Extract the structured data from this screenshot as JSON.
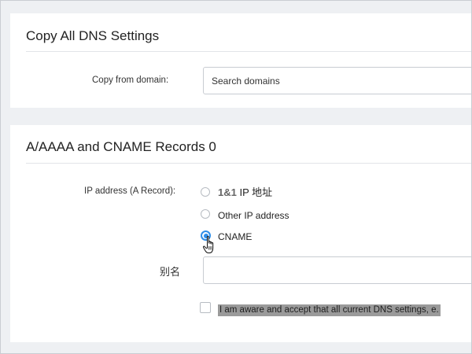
{
  "copy_section": {
    "title": "Copy All DNS Settings",
    "field_label": "Copy from domain:",
    "search_placeholder": "Search domains"
  },
  "records_section": {
    "title": "A/AAAA and CNAME Records 0",
    "ip_label": "IP address (A Record):",
    "options": [
      {
        "brand": "1&1",
        "label": " IP 地址",
        "selected": false
      },
      {
        "label": "Other IP address",
        "selected": false
      },
      {
        "label": "CNAME",
        "selected": true
      }
    ],
    "alias_label": "别名",
    "alias_value": "",
    "consent_text": "I am aware and accept that all current DNS settings, e.",
    "consent_checked": false
  },
  "colors": {
    "accent": "#2f8ee8",
    "page_background": "#eef0f3",
    "card_background": "#ffffff",
    "highlight": "#9a9a9a"
  }
}
